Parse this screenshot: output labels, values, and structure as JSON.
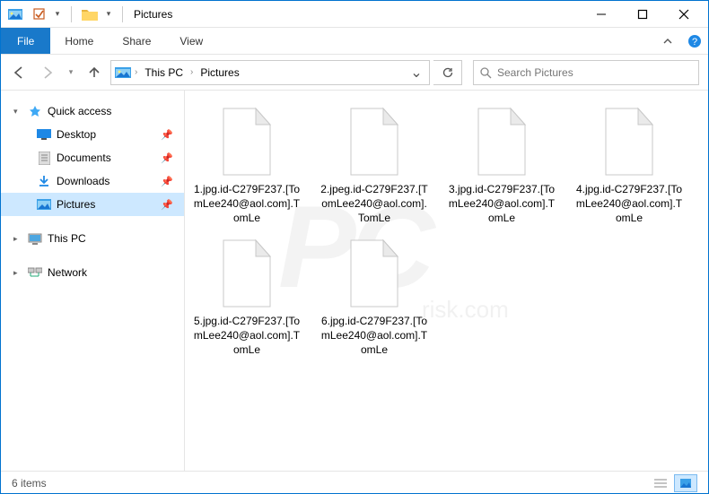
{
  "window": {
    "title": "Pictures"
  },
  "ribbon": {
    "file": "File",
    "tabs": [
      "Home",
      "Share",
      "View"
    ]
  },
  "breadcrumb": {
    "parts": [
      "This PC",
      "Pictures"
    ]
  },
  "search": {
    "placeholder": "Search Pictures"
  },
  "sidebar": {
    "quick_access": "Quick access",
    "items": [
      {
        "label": "Desktop",
        "icon": "desktop"
      },
      {
        "label": "Documents",
        "icon": "documents"
      },
      {
        "label": "Downloads",
        "icon": "downloads"
      },
      {
        "label": "Pictures",
        "icon": "pictures",
        "selected": true
      }
    ],
    "this_pc": "This PC",
    "network": "Network"
  },
  "files": [
    {
      "name": "1.jpg.id-C279F237.[TomLee240@aol.com].TomLe"
    },
    {
      "name": "2.jpeg.id-C279F237.[TomLee240@aol.com].TomLe"
    },
    {
      "name": "3.jpg.id-C279F237.[TomLee240@aol.com].TomLe"
    },
    {
      "name": "4.jpg.id-C279F237.[TomLee240@aol.com].TomLe"
    },
    {
      "name": "5.jpg.id-C279F237.[TomLee240@aol.com].TomLe"
    },
    {
      "name": "6.jpg.id-C279F237.[TomLee240@aol.com].TomLe"
    }
  ],
  "status": {
    "count": "6 items"
  }
}
